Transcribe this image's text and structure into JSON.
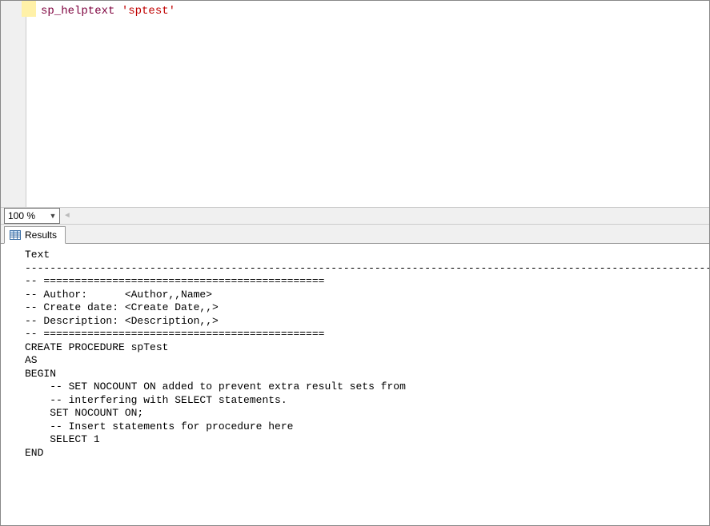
{
  "editor": {
    "code_tokens": {
      "builtin": "sp_helptext",
      "space": " ",
      "string": "'sptest'"
    }
  },
  "zoom": {
    "value": "100 %"
  },
  "tabs": {
    "results_label": "Results"
  },
  "results": {
    "column_header": "Text",
    "separator": "---------------------------------------------------------------------------------------------------------------------------------------",
    "lines": [
      "-- =============================================",
      "-- Author:      <Author,,Name>",
      "-- Create date: <Create Date,,>",
      "-- Description: <Description,,>",
      "-- =============================================",
      "CREATE PROCEDURE spTest",
      "AS",
      "BEGIN",
      "    -- SET NOCOUNT ON added to prevent extra result sets from",
      "    -- interfering with SELECT statements.",
      "    SET NOCOUNT ON;",
      "",
      "    -- Insert statements for procedure here",
      "    SELECT 1",
      "END"
    ]
  }
}
